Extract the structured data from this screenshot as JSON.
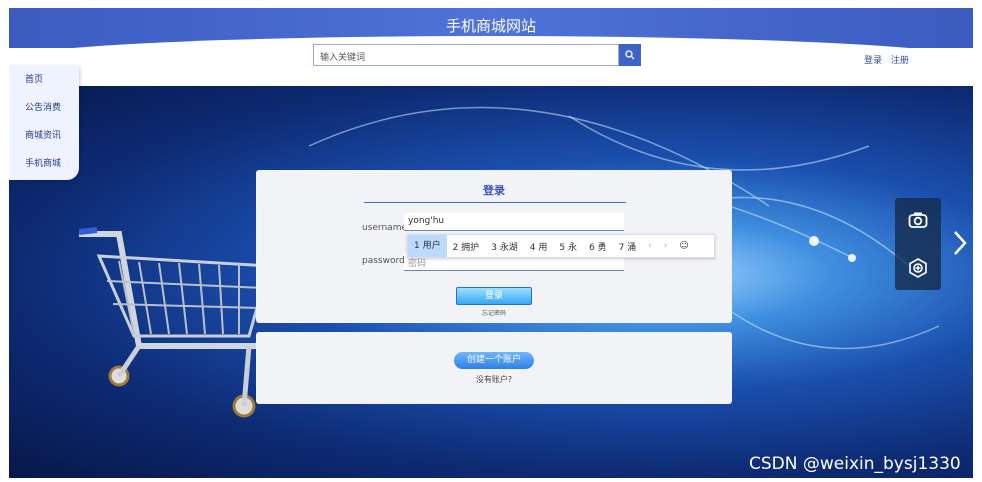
{
  "header": {
    "site_title": "手机商城网站",
    "search_placeholder": "输入关键词",
    "login_link": "登录",
    "register_link": "注册"
  },
  "sidebar": {
    "items": [
      {
        "label": "首页"
      },
      {
        "label": "公告消费"
      },
      {
        "label": "商城资讯"
      },
      {
        "label": "手机商城"
      }
    ]
  },
  "login": {
    "title": "登录",
    "username_label": "username:",
    "username_value": "yong'hu",
    "password_label": "password:",
    "password_placeholder": "密码",
    "submit_label": "登录",
    "forgot_label": "忘记密码"
  },
  "ime": {
    "candidates": [
      "1 用户",
      "2 拥护",
      "3 永湖",
      "4 用",
      "5 永",
      "6 勇",
      "7 涌"
    ],
    "prev": "‹",
    "next": "›",
    "emoji": "☺"
  },
  "register": {
    "button_label": "创建一个账户",
    "hint": "没有账户?"
  },
  "watermark": "CSDN @weixin_bysj1330",
  "colors": {
    "primary": "#3c63c8",
    "login_button": "#38a8f4"
  }
}
